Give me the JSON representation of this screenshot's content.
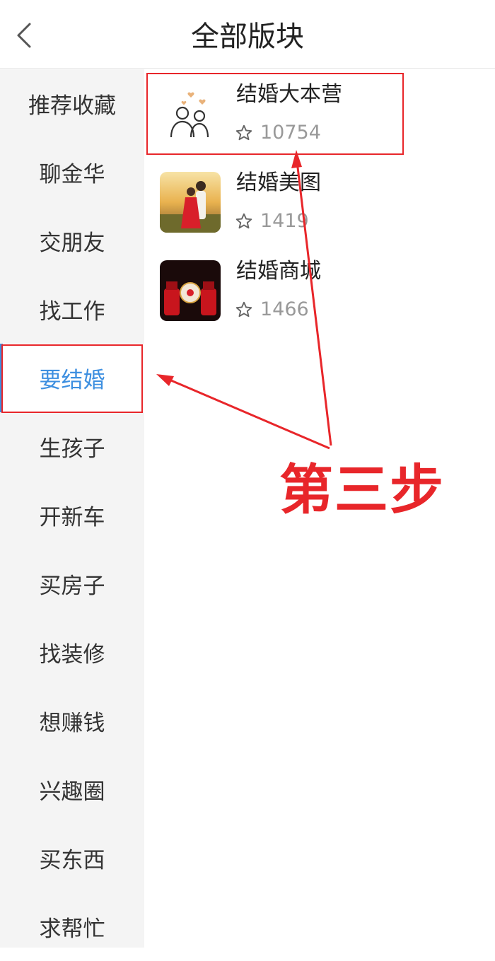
{
  "header": {
    "title": "全部版块"
  },
  "sidebar": {
    "items": [
      {
        "label": "推荐收藏"
      },
      {
        "label": "聊金华"
      },
      {
        "label": "交朋友"
      },
      {
        "label": "找工作"
      },
      {
        "label": "要结婚"
      },
      {
        "label": "生孩子"
      },
      {
        "label": "开新车"
      },
      {
        "label": "买房子"
      },
      {
        "label": "找装修"
      },
      {
        "label": "想赚钱"
      },
      {
        "label": "兴趣圈"
      },
      {
        "label": "买东西"
      },
      {
        "label": "求帮忙"
      }
    ],
    "selected": "要结婚"
  },
  "forums": [
    {
      "title": "结婚大本营",
      "count": "10754",
      "icon": "couple-outline-icon"
    },
    {
      "title": "结婚美图",
      "count": "1419",
      "icon": "wedding-photo-thumbnail"
    },
    {
      "title": "结婚商城",
      "count": "1466",
      "icon": "wedding-goods-thumbnail"
    }
  ],
  "annotation": {
    "step_label": "第三步",
    "color": "#e8262a"
  },
  "colors": {
    "accent": "#3d8fe0",
    "sidebar_bg": "#f4f4f4",
    "muted_text": "#999999"
  }
}
